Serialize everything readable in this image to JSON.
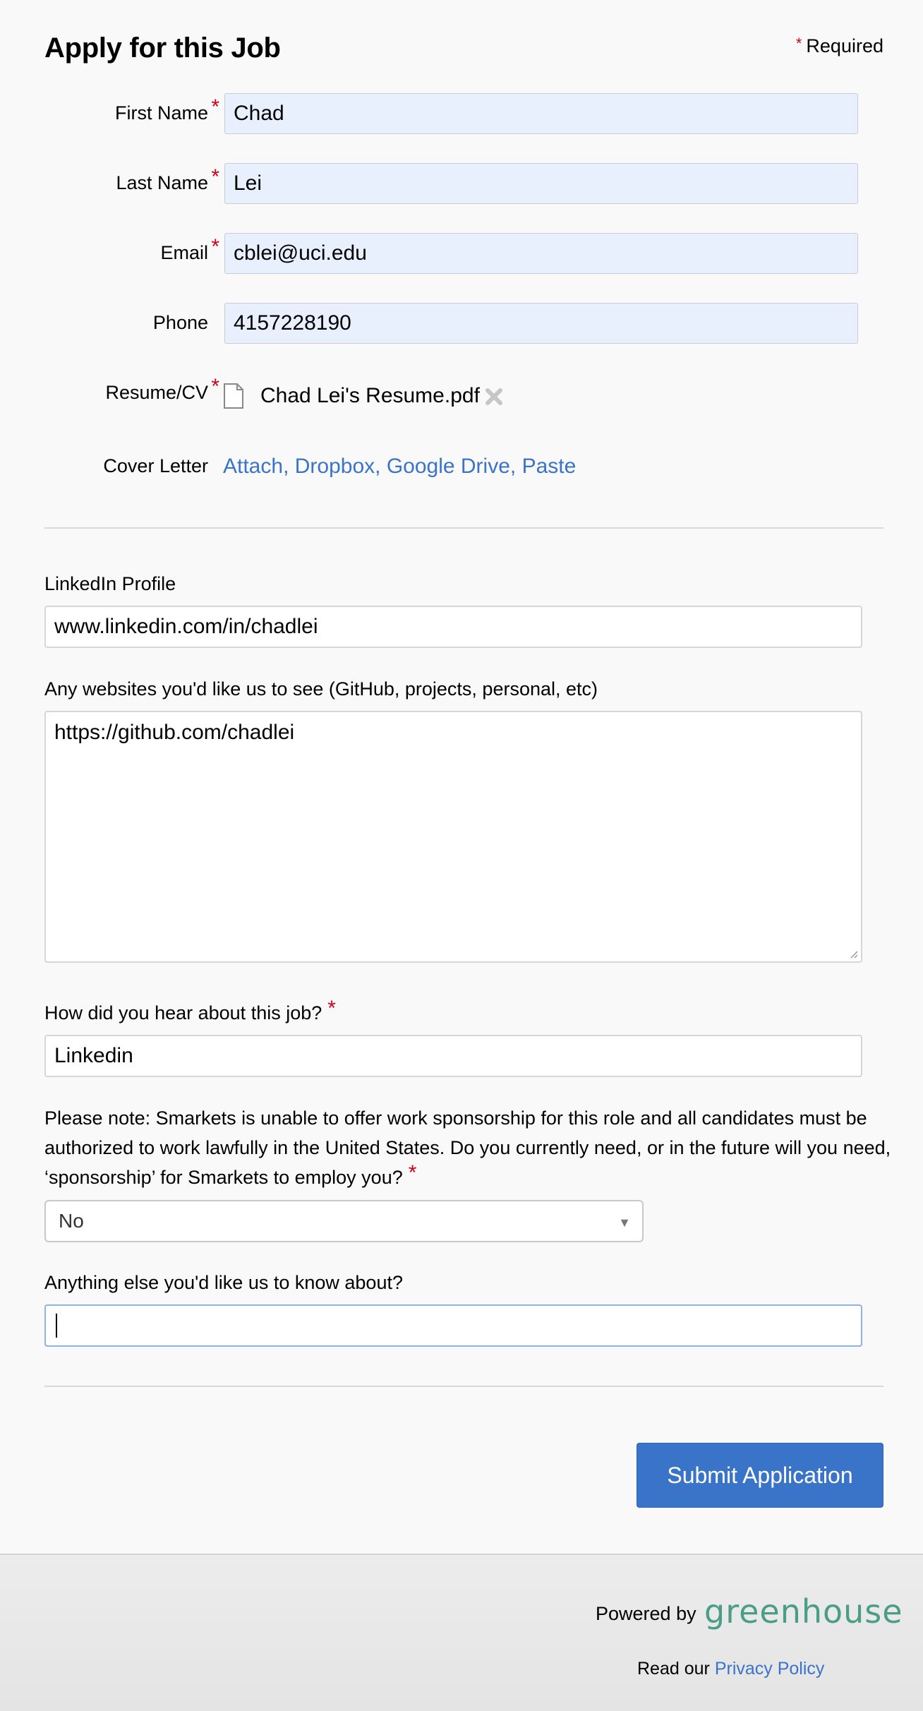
{
  "header": {
    "title": "Apply for this Job",
    "required_star": "*",
    "required_label": "Required"
  },
  "fields": {
    "first_name": {
      "label": "First Name",
      "value": "Chad"
    },
    "last_name": {
      "label": "Last Name",
      "value": "Lei"
    },
    "email": {
      "label": "Email",
      "value": "cblei@uci.edu"
    },
    "phone": {
      "label": "Phone",
      "value": "4157228190"
    },
    "resume": {
      "label": "Resume/CV",
      "file_name": "Chad Lei's Resume.pdf"
    },
    "cover_letter": {
      "label": "Cover Letter",
      "options": [
        "Attach",
        "Dropbox",
        "Google Drive",
        "Paste"
      ]
    }
  },
  "questions": {
    "linkedin": {
      "label": "LinkedIn Profile",
      "value": "www.linkedin.com/in/chadlei"
    },
    "websites": {
      "label": "Any websites you'd like us to see (GitHub, projects, personal, etc)",
      "value": "https://github.com/chadlei"
    },
    "hear": {
      "label": "How did you hear about this job?",
      "value": "Linkedin"
    },
    "sponsorship": {
      "label": "Please note: Smarkets is unable to offer work sponsorship for this role and all candidates must be authorized to work lawfully in the United States. Do you currently need, or in the future will you need, ‘sponsorship’ for Smarkets to employ you?",
      "selected": "No"
    },
    "anything_else": {
      "label": "Anything else you'd like us to know about?",
      "value": ""
    }
  },
  "actions": {
    "submit_label": "Submit Application"
  },
  "footer": {
    "powered_by": "Powered by",
    "brand": "greenhouse",
    "read_our": "Read our",
    "privacy_link": "Privacy Policy"
  },
  "colors": {
    "accent": "#3a74c9",
    "required": "#d0021b",
    "brand": "#4a9d86",
    "autofill_bg": "#e8f0fe"
  },
  "icons": {
    "file": "file-icon",
    "remove": "close-icon",
    "select_arrow": "chevron-down-icon"
  }
}
